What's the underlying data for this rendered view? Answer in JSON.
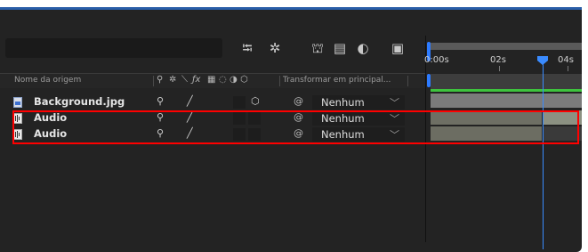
{
  "header": {
    "col_source_name": "Nome da origem",
    "col_parent": "Transformar em principal...",
    "switch_icons": [
      "puppet-pin-icon",
      "shy-icon",
      "quality-icon",
      "fx-icon",
      "frame-blend-icon",
      "motion-blur-icon",
      "adjustment-layer-icon",
      "3d-layer-icon"
    ]
  },
  "toolbar": {
    "icons": [
      "composition-flowchart-icon",
      "draft-3d-icon",
      "shy-layers-icon",
      "frame-blending-icon",
      "motion-blur-icon",
      "graph-editor-icon"
    ]
  },
  "ruler": {
    "labels": [
      "0:00s",
      "02s",
      "04s"
    ]
  },
  "layers": [
    {
      "name": "Background.jpg",
      "type": "image",
      "parent": "Nenhum"
    },
    {
      "name": "Audio",
      "type": "audio",
      "parent": "Nenhum"
    },
    {
      "name": "Audio",
      "type": "audio",
      "parent": "Nenhum"
    }
  ],
  "colors": {
    "accent": "#2d7bff",
    "highlight": "#ff0000",
    "work_area_green": "#3ec33e"
  }
}
